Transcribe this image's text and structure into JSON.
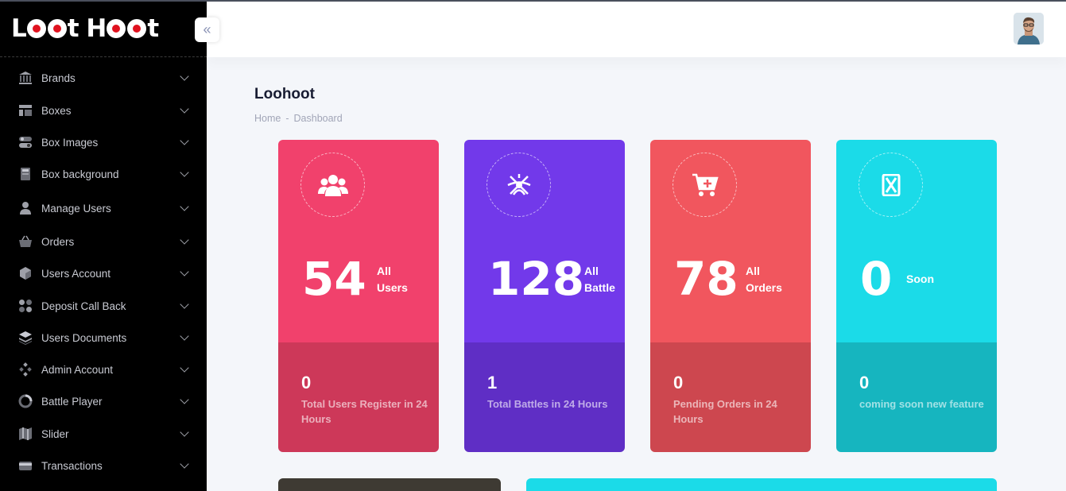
{
  "app": {
    "logo_text_a": "L",
    "logo_text_b": "t H",
    "logo_text_c": "t",
    "brand": "Loot Hoot"
  },
  "sidebar": {
    "collapse_icon": "double-chevron-left-icon",
    "items": [
      {
        "label": "Brands",
        "icon": "bank-icon"
      },
      {
        "label": "Boxes",
        "icon": "layout-icon"
      },
      {
        "label": "Box Images",
        "icon": "toggle-icon"
      },
      {
        "label": "Box background",
        "icon": "book-icon"
      },
      {
        "label": "Manage Users",
        "icon": "user-icon"
      },
      {
        "label": "Orders",
        "icon": "basket-icon"
      },
      {
        "label": "Users Account",
        "icon": "cube-icon"
      },
      {
        "label": "Deposit Call Back",
        "icon": "dots-grid-icon"
      },
      {
        "label": "Users Documents",
        "icon": "layers-icon"
      },
      {
        "label": "Admin Account",
        "icon": "diamond-dots-icon"
      },
      {
        "label": "Battle Player",
        "icon": "pie-icon"
      },
      {
        "label": "Slider",
        "icon": "map-icon"
      },
      {
        "label": "Transactions",
        "icon": "card-icon"
      }
    ]
  },
  "page": {
    "title": "Loohoot",
    "breadcrumb": [
      "Home",
      "-",
      "Dashboard"
    ]
  },
  "cards": [
    {
      "value": "54",
      "caption_1": "All",
      "caption_2": "Users",
      "bottom_value": "0",
      "bottom_text": "Total Users Register in 24 Hours",
      "icon": "users-icon",
      "color_top": "#f1416c",
      "color_bottom": "#cd3859"
    },
    {
      "value": "128",
      "caption_1": "All",
      "caption_2": "Battle",
      "bottom_value": "1",
      "bottom_text": "Total Battles in 24 Hours",
      "icon": "battle-icon",
      "color_top": "#7239ea",
      "color_bottom": "#5f2ec5"
    },
    {
      "value": "78",
      "caption_1": "All",
      "caption_2": "Orders",
      "bottom_value": "0",
      "bottom_text": "Pending Orders in 24 Hours",
      "icon": "cart-plus-icon",
      "color_top": "#f1565e",
      "color_bottom": "#cd474f"
    },
    {
      "value": "0",
      "caption_1": "Soon",
      "caption_2": "",
      "bottom_value": "0",
      "bottom_text": "coming soon new feature",
      "icon": "hourglass-icon",
      "color_top": "#1bdbe8",
      "color_bottom": "#16b5bf"
    }
  ],
  "colors": {
    "sidebar": "#000000",
    "panel_dark": "#3e3a33",
    "panel_cyan": "#1bdbe8"
  }
}
